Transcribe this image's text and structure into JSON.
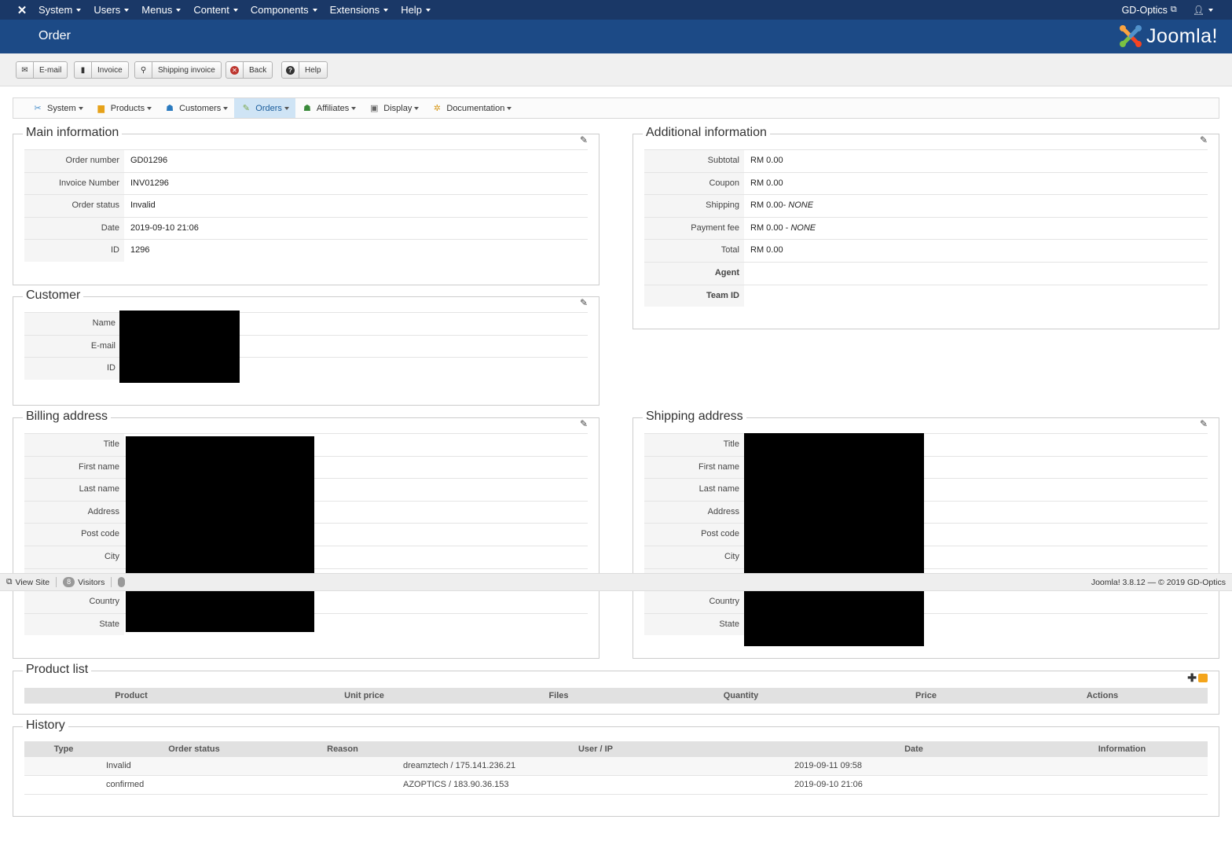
{
  "topnav": {
    "menus": [
      "System",
      "Users",
      "Menus",
      "Content",
      "Components",
      "Extensions",
      "Help"
    ],
    "site_name": "GD-Optics"
  },
  "header": {
    "title": "Order",
    "brand": "Joomla!"
  },
  "toolbar": {
    "email": "E-mail",
    "invoice": "Invoice",
    "shipping_invoice": "Shipping invoice",
    "back": "Back",
    "help": "Help"
  },
  "component_menu": {
    "items": [
      "System",
      "Products",
      "Customers",
      "Orders",
      "Affiliates",
      "Display",
      "Documentation"
    ],
    "active": "Orders"
  },
  "main_info": {
    "legend": "Main information",
    "rows": [
      {
        "label": "Order number",
        "value": "GD01296"
      },
      {
        "label": "Invoice Number",
        "value": "INV01296"
      },
      {
        "label": "Order status",
        "value": "Invalid"
      },
      {
        "label": "Date",
        "value": "2019-09-10 21:06"
      },
      {
        "label": "ID",
        "value": "1296"
      }
    ]
  },
  "additional_info": {
    "legend": "Additional information",
    "rows": [
      {
        "label": "Subtotal",
        "value": "RM 0.00",
        "note": ""
      },
      {
        "label": "Coupon",
        "value": "RM 0.00",
        "note": ""
      },
      {
        "label": "Shipping",
        "value": "RM 0.00- ",
        "note": "NONE"
      },
      {
        "label": "Payment fee",
        "value": "RM 0.00 - ",
        "note": "NONE"
      },
      {
        "label": "Total",
        "value": "RM 0.00",
        "note": ""
      },
      {
        "label": "Agent",
        "value": "",
        "note": ""
      },
      {
        "label": "Team ID",
        "value": "",
        "note": ""
      }
    ]
  },
  "customer": {
    "legend": "Customer",
    "rows": [
      {
        "label": "Name"
      },
      {
        "label": "E-mail"
      },
      {
        "label": "ID"
      }
    ]
  },
  "billing": {
    "legend": "Billing address",
    "rows": [
      {
        "label": "Title"
      },
      {
        "label": "First name"
      },
      {
        "label": "Last name"
      },
      {
        "label": "Address"
      },
      {
        "label": "Post code"
      },
      {
        "label": "City"
      },
      {
        "label": ""
      },
      {
        "label": "Country"
      },
      {
        "label": "State"
      }
    ]
  },
  "shipping": {
    "legend": "Shipping address",
    "rows": [
      {
        "label": "Title"
      },
      {
        "label": "First name"
      },
      {
        "label": "Last name"
      },
      {
        "label": "Address"
      },
      {
        "label": "Post code"
      },
      {
        "label": "City"
      },
      {
        "label": ""
      },
      {
        "label": "Country"
      },
      {
        "label": "State"
      }
    ]
  },
  "statusbar": {
    "view_site": "View Site",
    "visitors_count": "8",
    "visitors_label": "Visitors",
    "right_text": "Joomla! 3.8.12 — © 2019 GD-Optics"
  },
  "products": {
    "legend": "Product list",
    "columns": [
      "Product",
      "Unit price",
      "Files",
      "Quantity",
      "Price",
      "Actions"
    ]
  },
  "history": {
    "legend": "History",
    "columns": [
      "Type",
      "Order status",
      "Reason",
      "User / IP",
      "Date",
      "Information"
    ],
    "rows": [
      {
        "type": "",
        "status": "Invalid",
        "reason": "",
        "user": "dreamztech / 175.141.236.21",
        "date": "2019-09-11 09:58",
        "info": ""
      },
      {
        "type": "",
        "status": "confirmed",
        "reason": "",
        "user": "AZOPTICS / 183.90.36.153",
        "date": "2019-09-10 21:06",
        "info": ""
      }
    ]
  }
}
